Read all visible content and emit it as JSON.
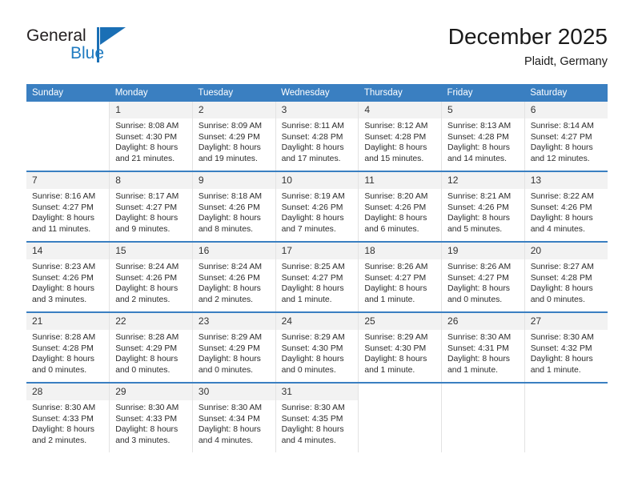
{
  "logo": {
    "word1": "General",
    "word2": "Blue",
    "icon": "triangle-logo-icon"
  },
  "header": {
    "title": "December 2025",
    "subtitle": "Plaidt, Germany"
  },
  "colors": {
    "header_blue": "#3a7fc1",
    "logo_blue": "#1f7bc1",
    "daynum_bg": "#f2f2f2",
    "cell_border": "#e3e3e3"
  },
  "weekday_headers": [
    "Sunday",
    "Monday",
    "Tuesday",
    "Wednesday",
    "Thursday",
    "Friday",
    "Saturday"
  ],
  "weeks": [
    [
      {
        "day": "",
        "sunrise": "",
        "sunset": "",
        "daylight1": "",
        "daylight2": ""
      },
      {
        "day": "1",
        "sunrise": "Sunrise: 8:08 AM",
        "sunset": "Sunset: 4:30 PM",
        "daylight1": "Daylight: 8 hours",
        "daylight2": "and 21 minutes."
      },
      {
        "day": "2",
        "sunrise": "Sunrise: 8:09 AM",
        "sunset": "Sunset: 4:29 PM",
        "daylight1": "Daylight: 8 hours",
        "daylight2": "and 19 minutes."
      },
      {
        "day": "3",
        "sunrise": "Sunrise: 8:11 AM",
        "sunset": "Sunset: 4:28 PM",
        "daylight1": "Daylight: 8 hours",
        "daylight2": "and 17 minutes."
      },
      {
        "day": "4",
        "sunrise": "Sunrise: 8:12 AM",
        "sunset": "Sunset: 4:28 PM",
        "daylight1": "Daylight: 8 hours",
        "daylight2": "and 15 minutes."
      },
      {
        "day": "5",
        "sunrise": "Sunrise: 8:13 AM",
        "sunset": "Sunset: 4:28 PM",
        "daylight1": "Daylight: 8 hours",
        "daylight2": "and 14 minutes."
      },
      {
        "day": "6",
        "sunrise": "Sunrise: 8:14 AM",
        "sunset": "Sunset: 4:27 PM",
        "daylight1": "Daylight: 8 hours",
        "daylight2": "and 12 minutes."
      }
    ],
    [
      {
        "day": "7",
        "sunrise": "Sunrise: 8:16 AM",
        "sunset": "Sunset: 4:27 PM",
        "daylight1": "Daylight: 8 hours",
        "daylight2": "and 11 minutes."
      },
      {
        "day": "8",
        "sunrise": "Sunrise: 8:17 AM",
        "sunset": "Sunset: 4:27 PM",
        "daylight1": "Daylight: 8 hours",
        "daylight2": "and 9 minutes."
      },
      {
        "day": "9",
        "sunrise": "Sunrise: 8:18 AM",
        "sunset": "Sunset: 4:26 PM",
        "daylight1": "Daylight: 8 hours",
        "daylight2": "and 8 minutes."
      },
      {
        "day": "10",
        "sunrise": "Sunrise: 8:19 AM",
        "sunset": "Sunset: 4:26 PM",
        "daylight1": "Daylight: 8 hours",
        "daylight2": "and 7 minutes."
      },
      {
        "day": "11",
        "sunrise": "Sunrise: 8:20 AM",
        "sunset": "Sunset: 4:26 PM",
        "daylight1": "Daylight: 8 hours",
        "daylight2": "and 6 minutes."
      },
      {
        "day": "12",
        "sunrise": "Sunrise: 8:21 AM",
        "sunset": "Sunset: 4:26 PM",
        "daylight1": "Daylight: 8 hours",
        "daylight2": "and 5 minutes."
      },
      {
        "day": "13",
        "sunrise": "Sunrise: 8:22 AM",
        "sunset": "Sunset: 4:26 PM",
        "daylight1": "Daylight: 8 hours",
        "daylight2": "and 4 minutes."
      }
    ],
    [
      {
        "day": "14",
        "sunrise": "Sunrise: 8:23 AM",
        "sunset": "Sunset: 4:26 PM",
        "daylight1": "Daylight: 8 hours",
        "daylight2": "and 3 minutes."
      },
      {
        "day": "15",
        "sunrise": "Sunrise: 8:24 AM",
        "sunset": "Sunset: 4:26 PM",
        "daylight1": "Daylight: 8 hours",
        "daylight2": "and 2 minutes."
      },
      {
        "day": "16",
        "sunrise": "Sunrise: 8:24 AM",
        "sunset": "Sunset: 4:26 PM",
        "daylight1": "Daylight: 8 hours",
        "daylight2": "and 2 minutes."
      },
      {
        "day": "17",
        "sunrise": "Sunrise: 8:25 AM",
        "sunset": "Sunset: 4:27 PM",
        "daylight1": "Daylight: 8 hours",
        "daylight2": "and 1 minute."
      },
      {
        "day": "18",
        "sunrise": "Sunrise: 8:26 AM",
        "sunset": "Sunset: 4:27 PM",
        "daylight1": "Daylight: 8 hours",
        "daylight2": "and 1 minute."
      },
      {
        "day": "19",
        "sunrise": "Sunrise: 8:26 AM",
        "sunset": "Sunset: 4:27 PM",
        "daylight1": "Daylight: 8 hours",
        "daylight2": "and 0 minutes."
      },
      {
        "day": "20",
        "sunrise": "Sunrise: 8:27 AM",
        "sunset": "Sunset: 4:28 PM",
        "daylight1": "Daylight: 8 hours",
        "daylight2": "and 0 minutes."
      }
    ],
    [
      {
        "day": "21",
        "sunrise": "Sunrise: 8:28 AM",
        "sunset": "Sunset: 4:28 PM",
        "daylight1": "Daylight: 8 hours",
        "daylight2": "and 0 minutes."
      },
      {
        "day": "22",
        "sunrise": "Sunrise: 8:28 AM",
        "sunset": "Sunset: 4:29 PM",
        "daylight1": "Daylight: 8 hours",
        "daylight2": "and 0 minutes."
      },
      {
        "day": "23",
        "sunrise": "Sunrise: 8:29 AM",
        "sunset": "Sunset: 4:29 PM",
        "daylight1": "Daylight: 8 hours",
        "daylight2": "and 0 minutes."
      },
      {
        "day": "24",
        "sunrise": "Sunrise: 8:29 AM",
        "sunset": "Sunset: 4:30 PM",
        "daylight1": "Daylight: 8 hours",
        "daylight2": "and 0 minutes."
      },
      {
        "day": "25",
        "sunrise": "Sunrise: 8:29 AM",
        "sunset": "Sunset: 4:30 PM",
        "daylight1": "Daylight: 8 hours",
        "daylight2": "and 1 minute."
      },
      {
        "day": "26",
        "sunrise": "Sunrise: 8:30 AM",
        "sunset": "Sunset: 4:31 PM",
        "daylight1": "Daylight: 8 hours",
        "daylight2": "and 1 minute."
      },
      {
        "day": "27",
        "sunrise": "Sunrise: 8:30 AM",
        "sunset": "Sunset: 4:32 PM",
        "daylight1": "Daylight: 8 hours",
        "daylight2": "and 1 minute."
      }
    ],
    [
      {
        "day": "28",
        "sunrise": "Sunrise: 8:30 AM",
        "sunset": "Sunset: 4:33 PM",
        "daylight1": "Daylight: 8 hours",
        "daylight2": "and 2 minutes."
      },
      {
        "day": "29",
        "sunrise": "Sunrise: 8:30 AM",
        "sunset": "Sunset: 4:33 PM",
        "daylight1": "Daylight: 8 hours",
        "daylight2": "and 3 minutes."
      },
      {
        "day": "30",
        "sunrise": "Sunrise: 8:30 AM",
        "sunset": "Sunset: 4:34 PM",
        "daylight1": "Daylight: 8 hours",
        "daylight2": "and 4 minutes."
      },
      {
        "day": "31",
        "sunrise": "Sunrise: 8:30 AM",
        "sunset": "Sunset: 4:35 PM",
        "daylight1": "Daylight: 8 hours",
        "daylight2": "and 4 minutes."
      },
      {
        "day": "",
        "sunrise": "",
        "sunset": "",
        "daylight1": "",
        "daylight2": ""
      },
      {
        "day": "",
        "sunrise": "",
        "sunset": "",
        "daylight1": "",
        "daylight2": ""
      },
      {
        "day": "",
        "sunrise": "",
        "sunset": "",
        "daylight1": "",
        "daylight2": ""
      }
    ]
  ]
}
